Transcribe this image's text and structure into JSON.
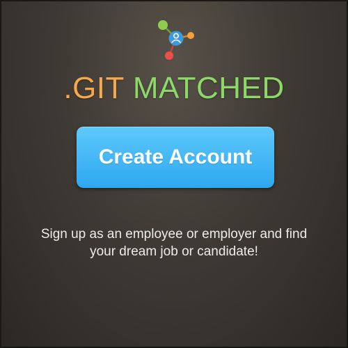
{
  "brand": {
    "part1": ".GIT",
    "part2": "MATCHED"
  },
  "logo": {
    "icon": "network-user-icon"
  },
  "main": {
    "create_account_label": "Create Account",
    "tagline": "Sign up as an employee or employer and find your dream job or candidate!"
  },
  "colors": {
    "brand_orange": "#f5a94a",
    "brand_green": "#8cd96a",
    "button_blue": "#3ab2f4",
    "node_blue": "#3d9ae0",
    "node_red": "#ec4f4a",
    "node_orange": "#f2a33a",
    "background": "#3f3a34"
  }
}
